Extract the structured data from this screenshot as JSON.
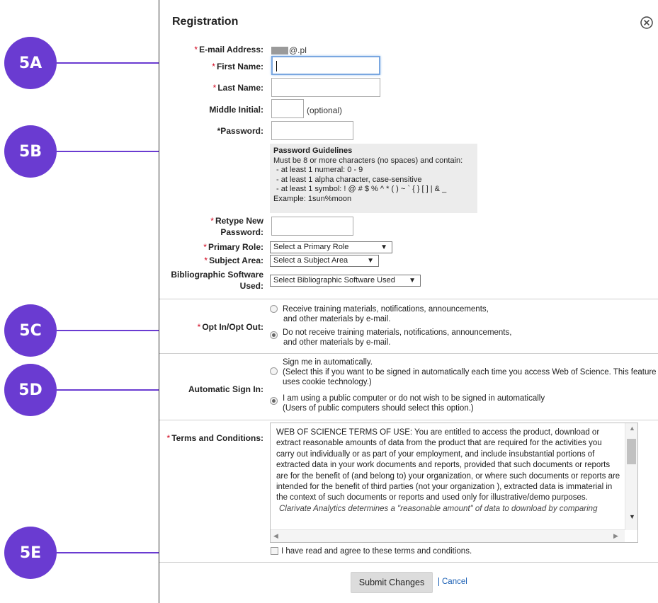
{
  "callouts": {
    "c5a": "5A",
    "c5b": "5B",
    "c5c": "5C",
    "c5d": "5D",
    "c5e": "5E"
  },
  "dialog": {
    "title": "Registration",
    "close_icon": "close-circle-icon"
  },
  "form": {
    "required_mark": "*",
    "email": {
      "label": "E-mail Address:",
      "value": "@.pl"
    },
    "first_name": {
      "label": "First Name:",
      "value": ""
    },
    "last_name": {
      "label": "Last Name:",
      "value": ""
    },
    "middle_initial": {
      "label": "Middle Initial:",
      "value": "",
      "hint": "(optional)"
    },
    "password": {
      "label": "*Password:",
      "value": ""
    },
    "guidelines": {
      "title": "Password Guidelines",
      "line1": "Must be 8 or more characters (no spaces) and contain:",
      "line2": "- at least 1 numeral: 0 - 9",
      "line3": "- at least 1 alpha character, case-sensitive",
      "line4": "- at least 1 symbol: ! @ # $ % ^ * ( ) ~ ` { } [ ] | & _",
      "line5": "Example: 1sun%moon"
    },
    "retype": {
      "label1": "Retype New",
      "label2": "Password:",
      "value": ""
    },
    "primary_role": {
      "label": "Primary Role:",
      "selected": "Select a Primary Role"
    },
    "subject_area": {
      "label": "Subject Area:",
      "selected": "Select a Subject Area"
    },
    "biblio": {
      "label1": "Bibliographic Software",
      "label2": "Used:",
      "selected": "Select Bibliographic Software Used"
    }
  },
  "optin": {
    "label": "Opt In/Opt Out:",
    "option1": [
      "Receive training materials, notifications, announcements,",
      "and other materials by e-mail."
    ],
    "option2": [
      "Do not receive training materials, notifications, announcements,",
      "and other materials by e-mail."
    ],
    "selected": 2
  },
  "autosign": {
    "label": "Automatic Sign In:",
    "option1": [
      "Sign me in automatically.",
      "(Select this if you want to be signed in automatically each time you access Web of Science. This feature",
      "uses cookie technology.)"
    ],
    "option2": [
      "I am using a public computer or do not wish to be signed in automatically",
      "(Users of public computers should select this option.)"
    ],
    "selected": 2
  },
  "terms": {
    "label": "Terms and Conditions:",
    "text": "WEB OF SCIENCE TERMS OF USE: You are entitled to access the product, download or extract reasonable amounts of data from the product that are required for the activities you carry out individually or as part of your employment, and include insubstantial portions of extracted data in your work documents and reports, provided that such documents or reports are for the benefit of (and belong to) your organization, or where such documents or reports are intended for the benefit of third parties (not your organization ), extracted data is immaterial in the context of such documents or reports and used only for illustrative/demo purposes.",
    "more": "Clarivate Analytics determines a \"reasonable amount\" of data to download by comparing",
    "agree": "I have read and agree to these terms and conditions.",
    "agreed": false
  },
  "actions": {
    "submit": "Submit Changes",
    "cancel": "Cancel"
  },
  "colors": {
    "callout": "#6a3bd1",
    "required": "#d0021b",
    "link": "#1a5fb4"
  }
}
